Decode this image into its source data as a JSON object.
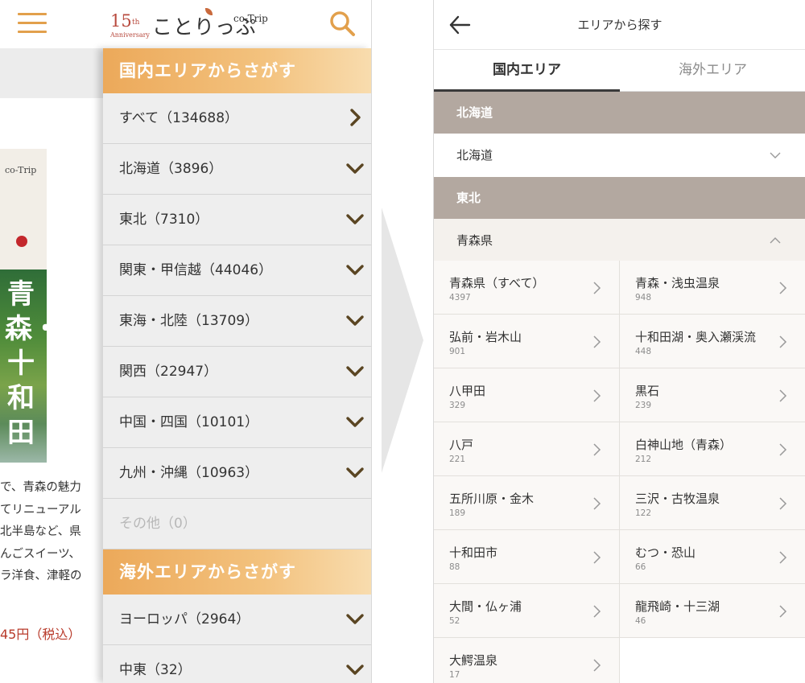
{
  "left": {
    "logo": {
      "years": "15",
      "th": "th",
      "anniversary": "Anniversary",
      "name": "ことりっぷ",
      "cotrip": "co-Trip"
    },
    "cover": {
      "cotrip": "co-Trip",
      "title": "青森・十和田"
    },
    "description": [
      "で、青森の魅力",
      "てリニューアル",
      "北半島など、県",
      "んごスイーツ、",
      "ラ洋食、津軽の"
    ],
    "price": "45円（税込）",
    "domestic_heading": "国内エリアからさがす",
    "domestic_items": [
      {
        "label": "すべて（134688）",
        "icon": "chevron-right-icon"
      },
      {
        "label": "北海道（3896）",
        "icon": "chevron-down-icon"
      },
      {
        "label": "東北（7310）",
        "icon": "chevron-down-icon"
      },
      {
        "label": "関東・甲信越（44046）",
        "icon": "chevron-down-icon"
      },
      {
        "label": "東海・北陸（13709）",
        "icon": "chevron-down-icon"
      },
      {
        "label": "関西（22947）",
        "icon": "chevron-down-icon"
      },
      {
        "label": "中国・四国（10101）",
        "icon": "chevron-down-icon"
      },
      {
        "label": "九州・沖縄（10963）",
        "icon": "chevron-down-icon"
      },
      {
        "label": "その他（0）",
        "icon": ""
      }
    ],
    "overseas_heading": "海外エリアからさがす",
    "overseas_items": [
      {
        "label": "ヨーロッパ（2964）",
        "icon": "chevron-down-icon"
      },
      {
        "label": "中東（32）",
        "icon": "chevron-down-icon"
      }
    ]
  },
  "right": {
    "title": "エリアから探す",
    "tabs": [
      "国内エリア",
      "海外エリア"
    ],
    "active_tab": "国内エリア",
    "region1": "北海道",
    "pref1": "北海道",
    "region2": "東北",
    "pref2": "青森県",
    "areas": [
      {
        "name": "青森県（すべて）",
        "count": "4397"
      },
      {
        "name": "青森・浅虫温泉",
        "count": "948"
      },
      {
        "name": "弘前・岩木山",
        "count": "901"
      },
      {
        "name": "十和田湖・奥入瀬渓流",
        "count": "448"
      },
      {
        "name": "八甲田",
        "count": "329"
      },
      {
        "name": "黒石",
        "count": "239"
      },
      {
        "name": "八戸",
        "count": "221"
      },
      {
        "name": "白神山地（青森）",
        "count": "212"
      },
      {
        "name": "五所川原・金木",
        "count": "189"
      },
      {
        "name": "三沢・古牧温泉",
        "count": "122"
      },
      {
        "name": "十和田市",
        "count": "88"
      },
      {
        "name": "むつ・恐山",
        "count": "66"
      },
      {
        "name": "大間・仏ヶ浦",
        "count": "52"
      },
      {
        "name": "龍飛崎・十三湖",
        "count": "46"
      },
      {
        "name": "大鰐温泉",
        "count": "17"
      }
    ]
  },
  "colors": {
    "accent_orange": "#e2a04c",
    "region_bar": "#b3a8a0",
    "price_red": "#b83a2a",
    "chevron_brown": "#5a4522"
  }
}
